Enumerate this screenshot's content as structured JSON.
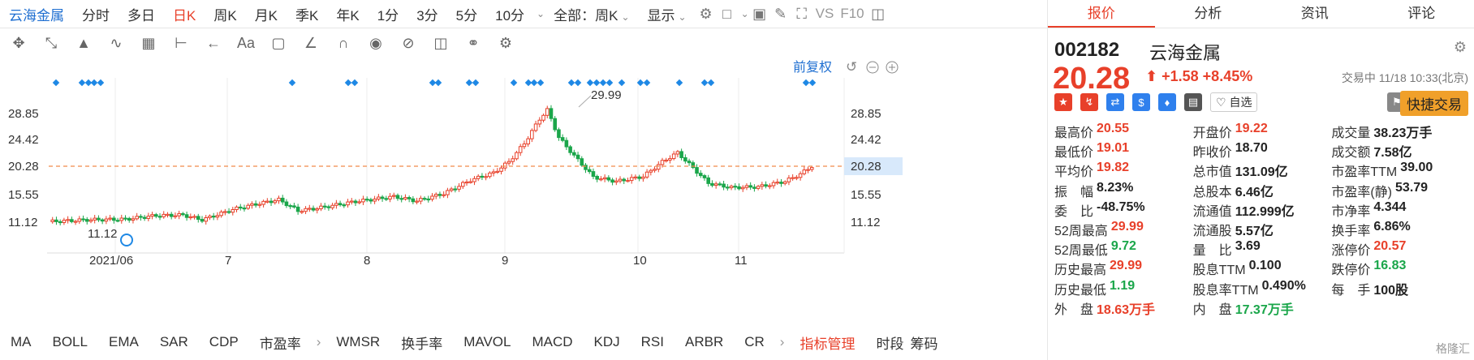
{
  "topbar": {
    "stock_name": "云海金属",
    "periods": [
      "分时",
      "多日",
      "日K",
      "周K",
      "月K",
      "季K",
      "年K",
      "1分",
      "3分",
      "5分",
      "10分"
    ],
    "active_period": "日K",
    "range_select": "全部：周K",
    "display_label": "显示",
    "vs_label": "VS",
    "f10_label": "F10"
  },
  "chart": {
    "adjust_label": "前复权",
    "y_ticks": [
      "28.85",
      "24.42",
      "20.28",
      "15.55",
      "11.12"
    ],
    "current_price_label": "20.28",
    "high_label": "29.99",
    "low_label": "11.12",
    "x_ticks": [
      "2021/06",
      "7",
      "8",
      "9",
      "10",
      "11"
    ],
    "accent_up": "#e8402a",
    "accent_down": "#1aa64a",
    "marker_color": "#1e88e5"
  },
  "indicators": [
    "MA",
    "BOLL",
    "EMA",
    "SAR",
    "CDP",
    "市盈率",
    "WMSR",
    "换手率",
    "MAVOL",
    "MACD",
    "KDJ",
    "RSI",
    "ARBR",
    "CR"
  ],
  "indicator_manage": "指标管理",
  "indicator_tail": [
    "时段",
    "筹码"
  ],
  "panel": {
    "tabs": [
      "报价",
      "分析",
      "资讯",
      "评论"
    ],
    "active_tab": "报价",
    "code": "002182",
    "name": "云海金属",
    "price": "20.28",
    "change": "+1.58",
    "change_pct": "+8.45%",
    "status": "交易中 11/18 10:33(北京)",
    "watch_label": "自选",
    "quick_trade": "快捷交易",
    "stats": [
      [
        {
          "l": "最高价",
          "v": "20.55",
          "c": "up"
        },
        {
          "l": "开盘价",
          "v": "19.22",
          "c": "up"
        },
        {
          "l": "成交量",
          "v": "38.23万手",
          "c": ""
        }
      ],
      [
        {
          "l": "最低价",
          "v": "19.01",
          "c": "up"
        },
        {
          "l": "昨收价",
          "v": "18.70",
          "c": ""
        },
        {
          "l": "成交额",
          "v": "7.58亿",
          "c": ""
        }
      ],
      [
        {
          "l": "平均价",
          "v": "19.82",
          "c": "up"
        },
        {
          "l": "总市值",
          "v": "131.09亿",
          "c": ""
        },
        {
          "l": "市盈率TTM",
          "v": "39.00",
          "c": ""
        }
      ],
      [
        {
          "l": "振　幅",
          "v": "8.23%",
          "c": ""
        },
        {
          "l": "总股本",
          "v": "6.46亿",
          "c": ""
        },
        {
          "l": "市盈率(静)",
          "v": "53.79",
          "c": ""
        }
      ],
      [
        {
          "l": "委　比",
          "v": "-48.75%",
          "c": ""
        },
        {
          "l": "流通值",
          "v": "112.999亿",
          "c": ""
        },
        {
          "l": "市净率",
          "v": "4.344",
          "c": ""
        }
      ],
      [
        {
          "l": "52周最高",
          "v": "29.99",
          "c": "up"
        },
        {
          "l": "流通股",
          "v": "5.57亿",
          "c": ""
        },
        {
          "l": "换手率",
          "v": "6.86%",
          "c": ""
        }
      ],
      [
        {
          "l": "52周最低",
          "v": "9.72",
          "c": "dn"
        },
        {
          "l": "量　比",
          "v": "3.69",
          "c": ""
        },
        {
          "l": "涨停价",
          "v": "20.57",
          "c": "up"
        }
      ],
      [
        {
          "l": "历史最高",
          "v": "29.99",
          "c": "up"
        },
        {
          "l": "股息TTM",
          "v": "0.100",
          "c": ""
        },
        {
          "l": "跌停价",
          "v": "16.83",
          "c": "dn"
        }
      ],
      [
        {
          "l": "历史最低",
          "v": "1.19",
          "c": "dn"
        },
        {
          "l": "股息率TTM",
          "v": "0.490%",
          "c": ""
        },
        {
          "l": "每　手",
          "v": "100股",
          "c": ""
        }
      ],
      [
        {
          "l": "外　盘",
          "v": "18.63万手",
          "c": "up"
        },
        {
          "l": "内　盘",
          "v": "17.37万手",
          "c": "dn"
        },
        {
          "l": "",
          "v": "",
          "c": ""
        }
      ]
    ]
  },
  "watermark": "格隆汇"
}
